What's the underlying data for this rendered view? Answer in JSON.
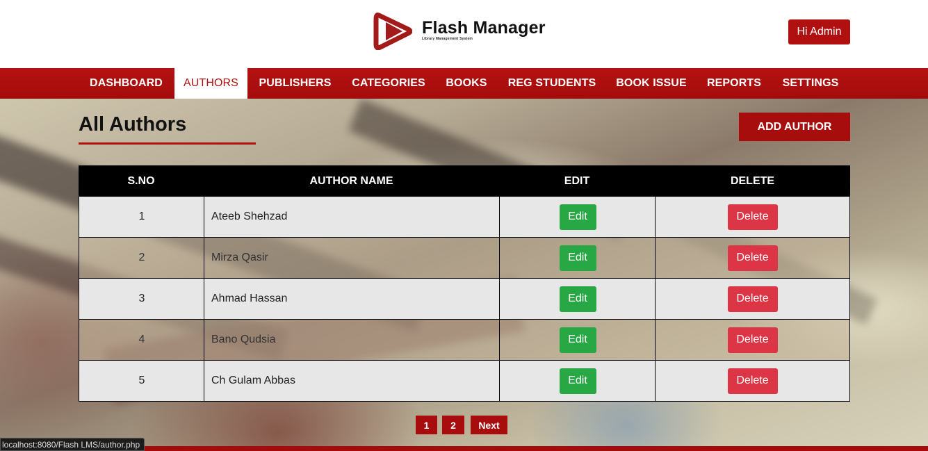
{
  "header": {
    "brand_title": "Flash Manager",
    "brand_subtitle": "Library Management System",
    "user_button": "Hi Admin",
    "brand_color": "#b01010"
  },
  "nav": {
    "items": [
      {
        "label": "DASHBOARD"
      },
      {
        "label": "AUTHORS",
        "active": true
      },
      {
        "label": "PUBLISHERS"
      },
      {
        "label": "CATEGORIES"
      },
      {
        "label": "BOOKS"
      },
      {
        "label": "REG STUDENTS"
      },
      {
        "label": "BOOK ISSUE"
      },
      {
        "label": "REPORTS"
      },
      {
        "label": "SETTINGS"
      }
    ]
  },
  "main": {
    "title": "All Authors",
    "add_button": "ADD AUTHOR",
    "table": {
      "headers": [
        "S.NO",
        "AUTHOR NAME",
        "EDIT",
        "DELETE"
      ],
      "rows": [
        {
          "sno": "1",
          "name": "Ateeb Shehzad",
          "edit": "Edit",
          "delete": "Delete"
        },
        {
          "sno": "2",
          "name": "Mirza Qasir",
          "edit": "Edit",
          "delete": "Delete"
        },
        {
          "sno": "3",
          "name": "Ahmad Hassan",
          "edit": "Edit",
          "delete": "Delete"
        },
        {
          "sno": "4",
          "name": "Bano Qudsia",
          "edit": "Edit",
          "delete": "Delete"
        },
        {
          "sno": "5",
          "name": "Ch Gulam Abbas",
          "edit": "Edit",
          "delete": "Delete"
        }
      ]
    },
    "pagination": {
      "pages": [
        "1",
        "2"
      ],
      "next_label": "Next"
    }
  },
  "status_bar": {
    "url": "localhost:8080/Flash LMS/author.php"
  },
  "colors": {
    "edit_button": "#28a745",
    "delete_button": "#dc3545",
    "header_row": "#000000"
  }
}
